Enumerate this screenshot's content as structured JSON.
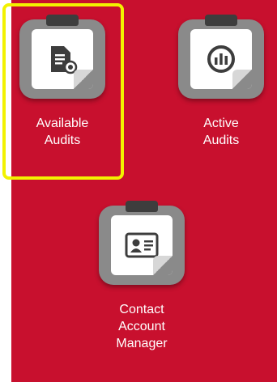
{
  "tiles": [
    {
      "label": "Available\nAudits",
      "icon": "document-audit-icon"
    },
    {
      "label": "Active\nAudits",
      "icon": "chart-circle-icon"
    },
    {
      "label": "Contact\nAccount\nManager",
      "icon": "contact-card-icon"
    }
  ],
  "colors": {
    "panel": "#c8102e",
    "board": "#8a8a8a",
    "icon": "#3d3d3d",
    "highlight": "#f2f200"
  }
}
